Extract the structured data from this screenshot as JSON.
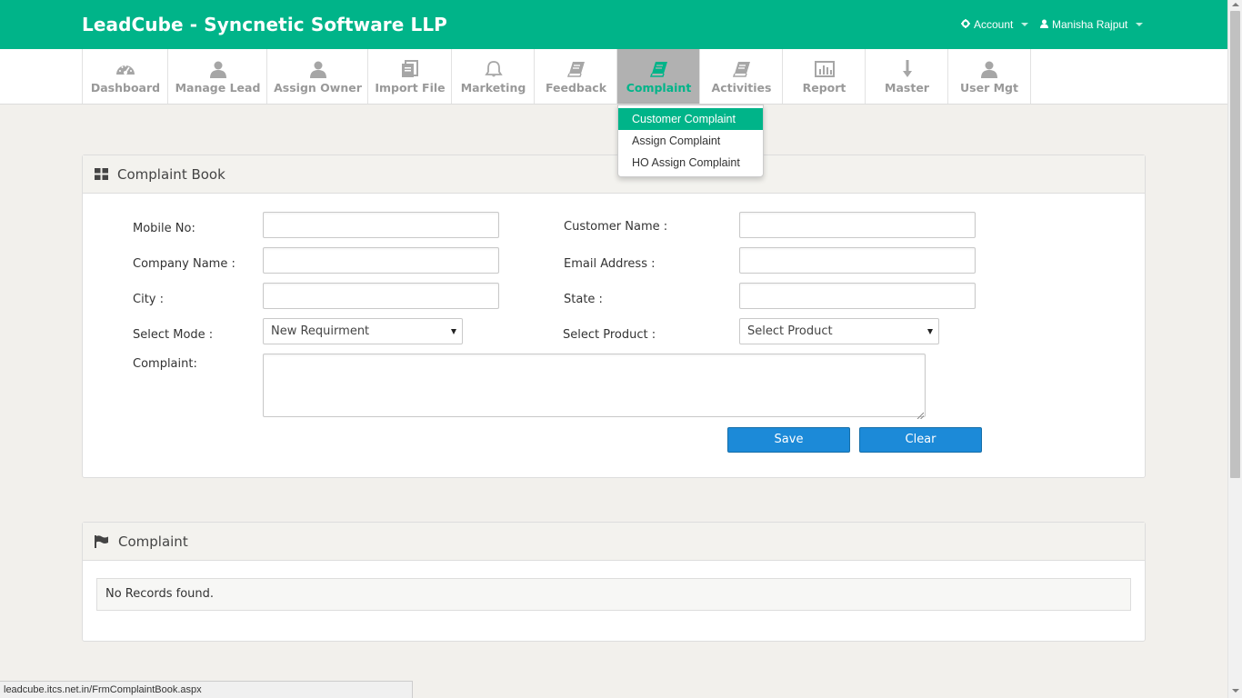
{
  "header": {
    "brand": "LeadCube - Syncnetic Software LLP",
    "account_label": "Account",
    "user_name": "Manisha Rajput",
    "bg_color": "#00b489"
  },
  "nav": {
    "items": [
      {
        "label": "Dashboard",
        "icon": "dashboard-icon"
      },
      {
        "label": "Manage Lead",
        "icon": "user-icon"
      },
      {
        "label": "Assign Owner",
        "icon": "user-icon"
      },
      {
        "label": "Import File",
        "icon": "files-icon"
      },
      {
        "label": "Marketing",
        "icon": "bell-icon"
      },
      {
        "label": "Feedback",
        "icon": "book-icon"
      },
      {
        "label": "Complaint",
        "icon": "book-icon",
        "active": true
      },
      {
        "label": "Activities",
        "icon": "book-icon"
      },
      {
        "label": "Report",
        "icon": "bar-chart-icon"
      },
      {
        "label": "Master",
        "icon": "arrow-down-icon"
      },
      {
        "label": "User Mgt",
        "icon": "user-icon"
      }
    ]
  },
  "dropdown": {
    "items": [
      "Customer Complaint",
      "Assign Complaint",
      "HO Assign Complaint"
    ],
    "selected": "Customer Complaint"
  },
  "complaint_book": {
    "title": "Complaint Book",
    "labels": {
      "mobile": "Mobile No:",
      "customer_name": "Customer Name :",
      "company_name": "Company Name :",
      "email": "Email Address :",
      "city": "City :",
      "state": "State :",
      "mode": "Select Mode :",
      "product": "Select Product :",
      "complaint": "Complaint:"
    },
    "values": {
      "mobile": "",
      "customer_name": "",
      "company_name": "",
      "email": "",
      "city": "",
      "state": "",
      "complaint": ""
    },
    "mode_selected": "New Requirment",
    "product_selected": "Select Product",
    "save_label": "Save",
    "clear_label": "Clear",
    "button_color": "#1c8ad8"
  },
  "complaint_list": {
    "title": "Complaint",
    "empty_message": "No Records found."
  },
  "status_bar": {
    "url": "leadcube.itcs.net.in/FrmComplaintBook.aspx"
  }
}
